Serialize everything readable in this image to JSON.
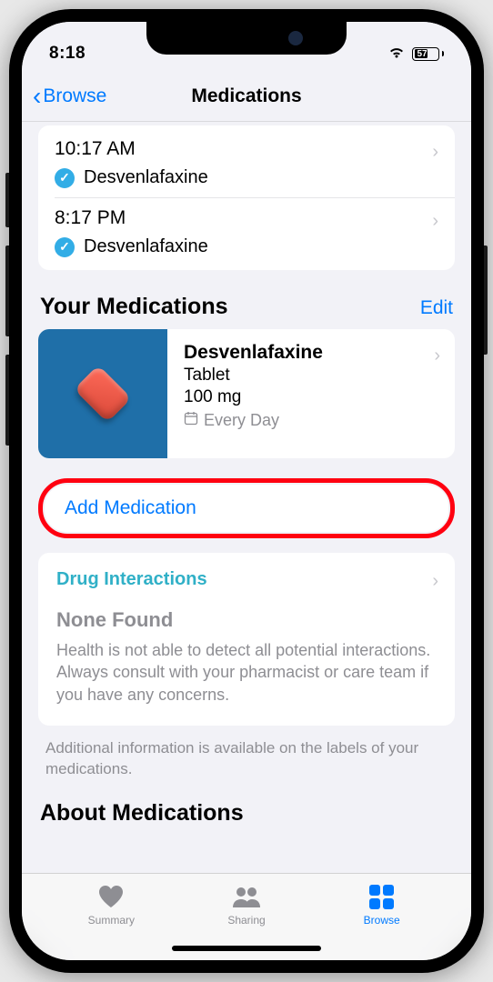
{
  "statusBar": {
    "time": "8:18",
    "batteryPercent": "57"
  },
  "nav": {
    "back": "Browse",
    "title": "Medications"
  },
  "schedule": [
    {
      "time": "10:17 AM",
      "med": "Desvenlafaxine"
    },
    {
      "time": "8:17 PM",
      "med": "Desvenlafaxine"
    }
  ],
  "yourMeds": {
    "title": "Your Medications",
    "editLabel": "Edit",
    "items": [
      {
        "name": "Desvenlafaxine",
        "form": "Tablet",
        "dose": "100 mg",
        "frequency": "Every Day"
      }
    ]
  },
  "addMedLabel": "Add Medication",
  "interactions": {
    "title": "Drug Interactions",
    "status": "None Found",
    "desc": "Health is not able to detect all potential interactions. Always consult with your pharmacist or care team if you have any concerns."
  },
  "footnote": "Additional information is available on the labels of your medications.",
  "aboutTitle": "About Medications",
  "tabs": {
    "summary": "Summary",
    "sharing": "Sharing",
    "browse": "Browse"
  }
}
